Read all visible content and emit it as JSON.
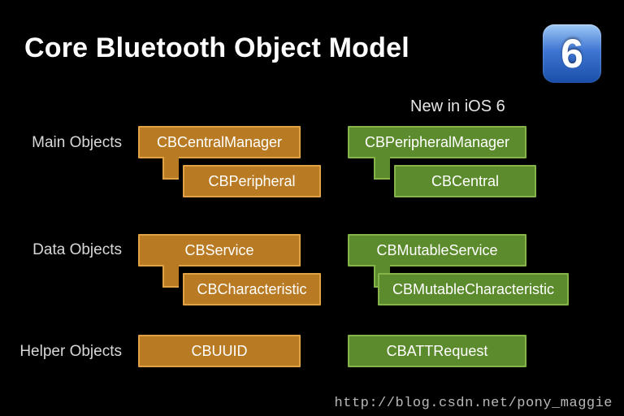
{
  "title": "Core Bluetooth Object Model",
  "badge_text": "6",
  "new_label": "New in iOS 6",
  "rows": {
    "main": "Main Objects",
    "data": "Data Objects",
    "helper": "Helper Objects"
  },
  "col_a": {
    "main_parent": "CBCentralManager",
    "main_child": "CBPeripheral",
    "data_parent": "CBService",
    "data_child": "CBCharacteristic",
    "helper": "CBUUID"
  },
  "col_b": {
    "main_parent": "CBPeripheralManager",
    "main_child": "CBCentral",
    "data_parent": "CBMutableService",
    "data_child": "CBMutableCharacteristic",
    "helper": "CBATTRequest"
  },
  "watermark": "http://blog.csdn.net/pony_maggie"
}
